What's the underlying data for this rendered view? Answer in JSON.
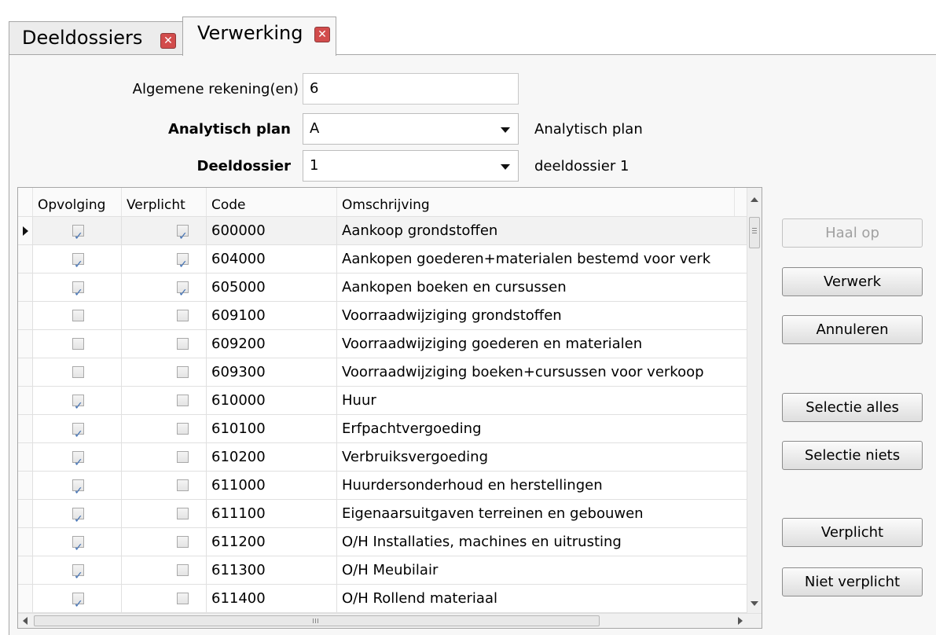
{
  "tabs": [
    {
      "label": "Deeldossiers",
      "active": false
    },
    {
      "label": "Verwerking",
      "active": true
    }
  ],
  "form": {
    "algemene_label": "Algemene rekening(en)",
    "algemene_value": "6",
    "analytisch_label": "Analytisch plan",
    "analytisch_value": "A",
    "analytisch_desc": "Analytisch plan",
    "deeldossier_label": "Deeldossier",
    "deeldossier_value": "1",
    "deeldossier_desc": "deeldossier 1"
  },
  "grid": {
    "columns": [
      "Opvolging",
      "Verplicht",
      "Code",
      "Omschrijving"
    ],
    "rows": [
      {
        "opvolging": true,
        "verplicht": true,
        "code": "600000",
        "omschrijving": "Aankoop grondstoffen",
        "selected": true
      },
      {
        "opvolging": true,
        "verplicht": true,
        "code": "604000",
        "omschrijving": "Aankopen goederen+materialen bestemd voor verk"
      },
      {
        "opvolging": true,
        "verplicht": true,
        "code": "605000",
        "omschrijving": "Aankopen boeken en cursussen"
      },
      {
        "opvolging": false,
        "verplicht": false,
        "code": "609100",
        "omschrijving": "Voorraadwijziging grondstoffen"
      },
      {
        "opvolging": false,
        "verplicht": false,
        "code": "609200",
        "omschrijving": "Voorraadwijziging goederen en materialen"
      },
      {
        "opvolging": false,
        "verplicht": false,
        "code": "609300",
        "omschrijving": "Voorraadwijziging boeken+cursussen voor verkoop"
      },
      {
        "opvolging": true,
        "verplicht": false,
        "code": "610000",
        "omschrijving": "Huur"
      },
      {
        "opvolging": true,
        "verplicht": false,
        "code": "610100",
        "omschrijving": "Erfpachtvergoeding"
      },
      {
        "opvolging": true,
        "verplicht": false,
        "code": "610200",
        "omschrijving": "Verbruiksvergoeding"
      },
      {
        "opvolging": true,
        "verplicht": false,
        "code": "611000",
        "omschrijving": "Huurdersonderhoud en herstellingen"
      },
      {
        "opvolging": true,
        "verplicht": false,
        "code": "611100",
        "omschrijving": "Eigenaarsuitgaven terreinen en  gebouwen"
      },
      {
        "opvolging": true,
        "verplicht": false,
        "code": "611200",
        "omschrijving": "O/H Installaties, machines en uitrusting"
      },
      {
        "opvolging": true,
        "verplicht": false,
        "code": "611300",
        "omschrijving": "O/H Meubilair"
      },
      {
        "opvolging": true,
        "verplicht": false,
        "code": "611400",
        "omschrijving": "O/H Rollend materiaal"
      }
    ],
    "hscroll_grip": "III"
  },
  "buttons": {
    "haal_op": "Haal op",
    "verwerk": "Verwerk",
    "annuleren": "Annuleren",
    "selectie_alles": "Selectie alles",
    "selectie_niets": "Selectie niets",
    "verplicht": "Verplicht",
    "niet_verplicht": "Niet verplicht"
  }
}
